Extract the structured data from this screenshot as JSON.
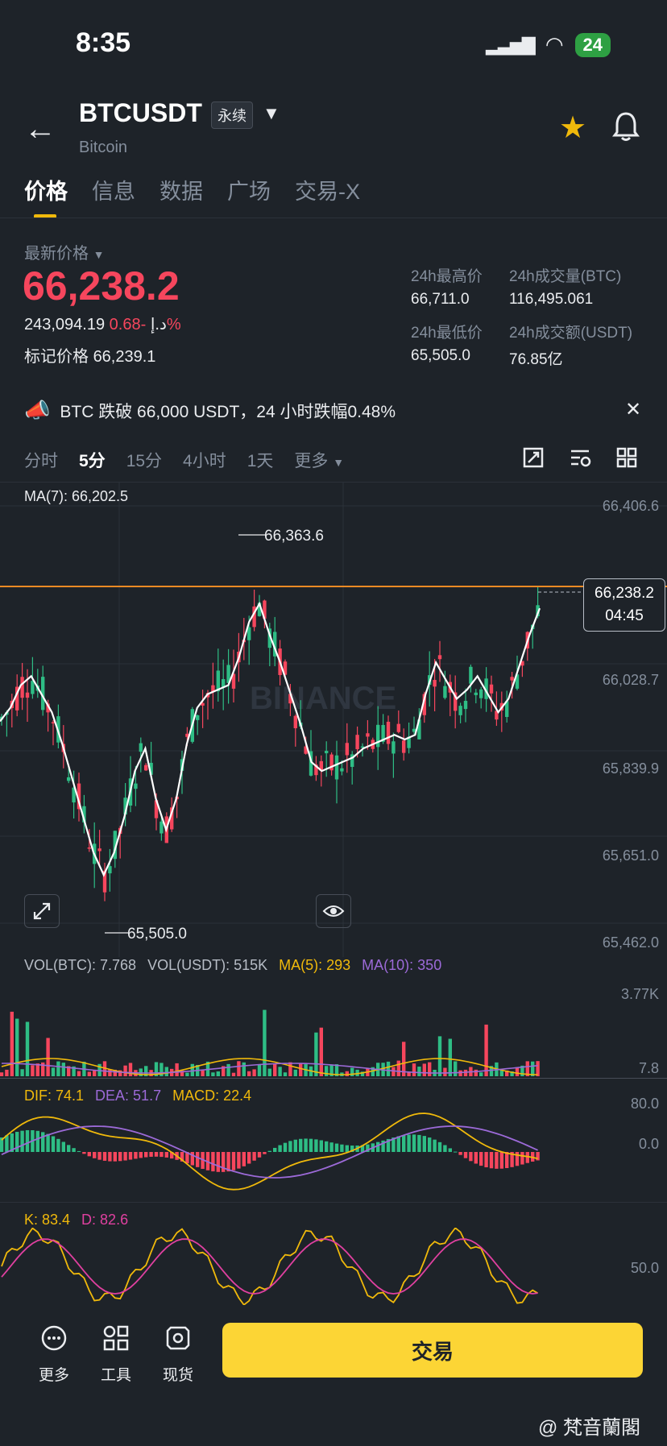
{
  "status_bar": {
    "time": "8:35",
    "battery": "24"
  },
  "header": {
    "symbol": "BTCUSDT",
    "badge": "永续",
    "subtitle": "Bitcoin"
  },
  "tabs": [
    {
      "label": "价格",
      "active": true
    },
    {
      "label": "信息",
      "active": false
    },
    {
      "label": "数据",
      "active": false
    },
    {
      "label": "广场",
      "active": false
    },
    {
      "label": "交易-X",
      "active": false
    }
  ],
  "price": {
    "label": "最新价格",
    "last": "66,238.2",
    "secondary": "243,094.19 د.إ",
    "change_pct": "-0.68%",
    "mark_label": "标记价格",
    "mark_value": "66,239.1"
  },
  "stats": {
    "high_label": "24h最高价",
    "high_value": "66,711.0",
    "low_label": "24h最低价",
    "low_value": "65,505.0",
    "vol_btc_label": "24h成交量(BTC)",
    "vol_btc_value": "116,495.061",
    "vol_usdt_label": "24h成交额(USDT)",
    "vol_usdt_value": "76.85亿"
  },
  "announcement": "BTC 跌破 66,000 USDT，24 小时跌幅0.48%",
  "timeframes": [
    {
      "label": "分时",
      "active": false
    },
    {
      "label": "5分",
      "active": true
    },
    {
      "label": "15分",
      "active": false
    },
    {
      "label": "4小时",
      "active": false
    },
    {
      "label": "1天",
      "active": false
    },
    {
      "label": "更多",
      "active": false
    }
  ],
  "chart": {
    "ma7": "MA(7): 66,202.5",
    "y_labels": [
      "66,406.6",
      "66,028.7",
      "65,839.9",
      "65,651.0",
      "65,462.0"
    ],
    "high_marker": "66,363.6",
    "low_marker": "65,505.0",
    "current_price": "66,238.2",
    "countdown": "04:45",
    "watermark": "BINANCE"
  },
  "volume": {
    "vol_btc": "VOL(BTC): 7.768",
    "vol_usdt": "VOL(USDT): 515K",
    "ma5": "MA(5): 293",
    "ma10": "MA(10): 350",
    "y_top": "3.77K",
    "y_bottom": "7.8"
  },
  "macd": {
    "dif": "DIF: 74.1",
    "dea": "DEA: 51.7",
    "macd": "MACD: 22.4",
    "y_top": "80.0",
    "y_mid": "0.0"
  },
  "kdj": {
    "k": "K: 83.4",
    "d": "D: 82.6",
    "y_mid": "50.0"
  },
  "bottom_nav": [
    {
      "label": "更多",
      "icon": "more-icon"
    },
    {
      "label": "工具",
      "icon": "tools-icon"
    },
    {
      "label": "现货",
      "icon": "spot-icon"
    }
  ],
  "trade_button": "交易",
  "watermark_footer": "@ 梵音蘭閣",
  "colors": {
    "up": "#2ebd85",
    "down": "#f6465d",
    "accent": "#f0b90b",
    "button": "#fcd535"
  },
  "chart_data": {
    "type": "line",
    "title": "",
    "xlabel": "",
    "ylabel": "",
    "ylim": [
      65462.0,
      66406.6
    ],
    "ma7_close": [
      65930,
      65960,
      66010,
      66030,
      65990,
      65950,
      65880,
      65800,
      65720,
      65640,
      65590,
      65640,
      65720,
      65820,
      65870,
      65760,
      65690,
      65760,
      65880,
      65960,
      65990,
      66000,
      66010,
      66070,
      66150,
      66190,
      66120,
      66060,
      65990,
      65920,
      65840,
      65820,
      65830,
      65840,
      65850,
      65870,
      65880,
      65890,
      65900,
      65890,
      65900,
      65990,
      66060,
      66020,
      65980,
      66000,
      66030,
      65990,
      65950,
      65980,
      66050,
      66120,
      66180
    ]
  }
}
